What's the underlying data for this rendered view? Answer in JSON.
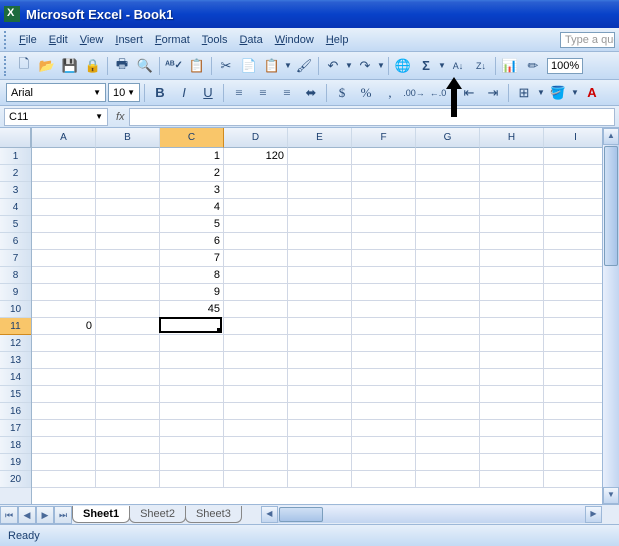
{
  "title": "Microsoft Excel - Book1",
  "menu": [
    "File",
    "Edit",
    "View",
    "Insert",
    "Format",
    "Tools",
    "Data",
    "Window",
    "Help"
  ],
  "helpPlaceholder": "Type a que",
  "zoom": "100%",
  "font": {
    "name": "Arial",
    "size": "10"
  },
  "nameBox": "C11",
  "formula": "",
  "columns": [
    "A",
    "B",
    "C",
    "D",
    "E",
    "F",
    "G",
    "H",
    "I"
  ],
  "selectedCol": "C",
  "selectedRow": 11,
  "rows": 20,
  "cells": {
    "1": {
      "C": "1",
      "D": "120"
    },
    "2": {
      "C": "2"
    },
    "3": {
      "C": "3"
    },
    "4": {
      "C": "4"
    },
    "5": {
      "C": "5"
    },
    "6": {
      "C": "6"
    },
    "7": {
      "C": "7"
    },
    "8": {
      "C": "8"
    },
    "9": {
      "C": "9"
    },
    "10": {
      "C": "45"
    },
    "11": {
      "A": "0"
    }
  },
  "sheets": [
    "Sheet1",
    "Sheet2",
    "Sheet3"
  ],
  "activeSheet": "Sheet1",
  "status": "Ready"
}
